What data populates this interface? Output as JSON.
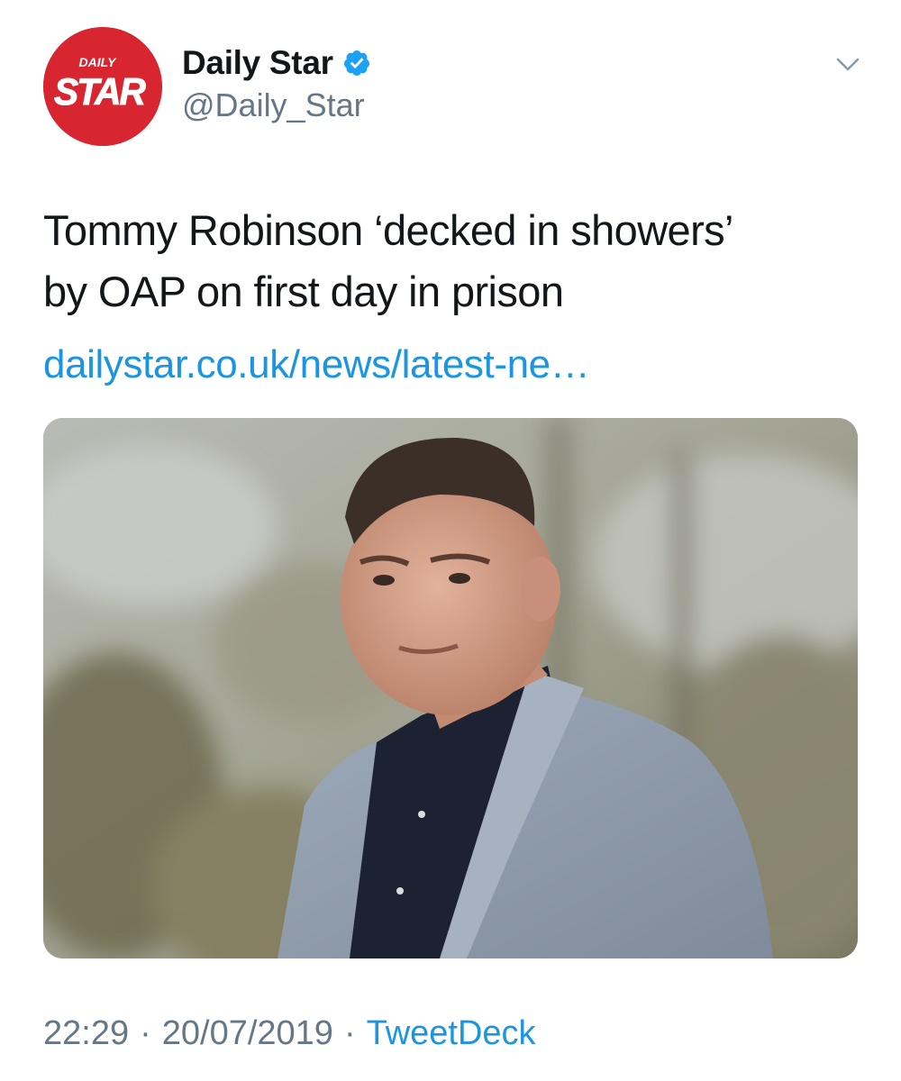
{
  "account": {
    "display_name": "Daily Star",
    "handle": "@Daily_Star",
    "avatar_label_top": "DAILY",
    "avatar_label_main": "STAR",
    "avatar_color": "#d7262f",
    "verified": true,
    "verified_icon": "verified-badge-icon"
  },
  "tweet": {
    "text_lines": [
      "Tommy Robinson ‘decked in showers’",
      "by OAP on first day in prison"
    ],
    "link": "dailystar.co.uk/news/latest-ne…",
    "menu_icon": "chevron-down-icon"
  },
  "footer": {
    "time": "22:29",
    "date": "20/07/2019",
    "separator": "·",
    "source": "TweetDeck"
  },
  "colors": {
    "text": "#14171a",
    "secondary": "#657786",
    "link": "#1b95e0",
    "verified": "#1da1f2"
  }
}
